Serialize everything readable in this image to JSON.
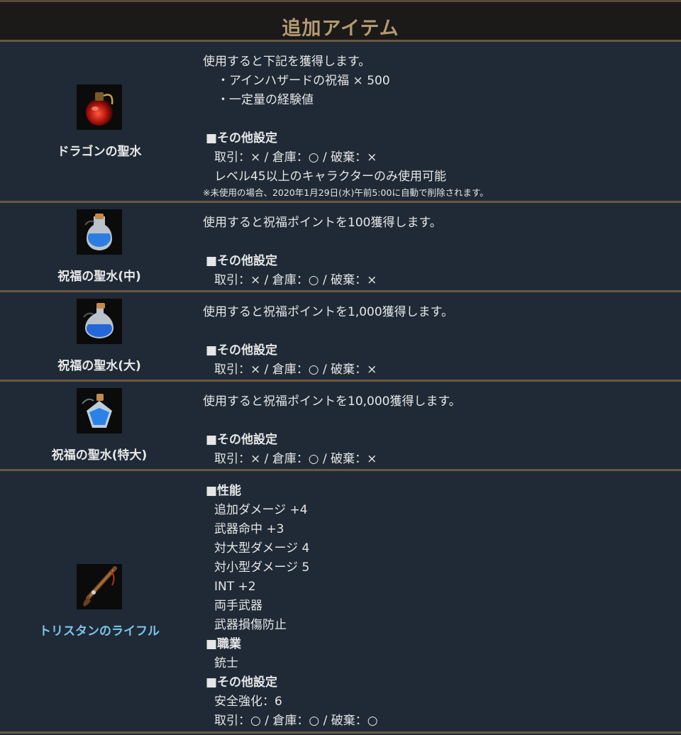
{
  "header": {
    "title": "追加アイテム"
  },
  "items": [
    {
      "name": "ドラゴンの聖水",
      "icon": "red-potion-icon",
      "desc": "使用すると下記を獲得します。",
      "bullets": [
        "・アインハザードの祝福 × 500",
        "・一定量の経験値"
      ],
      "settings_head": "■その他設定",
      "settings": [
        "取引：× / 倉庫：○ / 破棄：×",
        "レベル45以上のキャラクターのみ使用可能"
      ],
      "note": "※未使用の場合、2020年1月29日(水)午前5:00に自動で削除されます。"
    },
    {
      "name": "祝福の聖水(中)",
      "icon": "blue-potion-icon",
      "desc": "使用すると祝福ポイントを100獲得します。",
      "settings_head": "■その他設定",
      "settings": [
        "取引：× / 倉庫：○ / 破棄：×"
      ]
    },
    {
      "name": "祝福の聖水(大)",
      "icon": "blue-potion-icon",
      "desc": "使用すると祝福ポイントを1,000獲得します。",
      "settings_head": "■その他設定",
      "settings": [
        "取引：× / 倉庫：○ / 破棄：×"
      ]
    },
    {
      "name": "祝福の聖水(特大)",
      "icon": "blue-crystal-potion-icon",
      "desc": "使用すると祝福ポイントを10,000獲得します。",
      "settings_head": "■その他設定",
      "settings": [
        "取引：× / 倉庫：○ / 破棄：×"
      ]
    },
    {
      "name": "トリスタンのライフル",
      "icon": "rifle-icon",
      "perf_head": "■性能",
      "perf": [
        "追加ダメージ +4",
        "武器命中 +3",
        "対大型ダメージ 4",
        "対小型ダメージ 5",
        "INT +2",
        "両手武器",
        "武器損傷防止"
      ],
      "class_head": "■職業",
      "class": [
        "銃士"
      ],
      "settings_head": "■その他設定",
      "settings": [
        "安全強化：6",
        "取引：○ / 倉庫：○ / 破棄：○"
      ]
    }
  ],
  "colors": {
    "background": "#1f2a36",
    "divider": "#6b5843",
    "header_text": "#b39a72",
    "highlight_name": "#7cc4e8"
  }
}
